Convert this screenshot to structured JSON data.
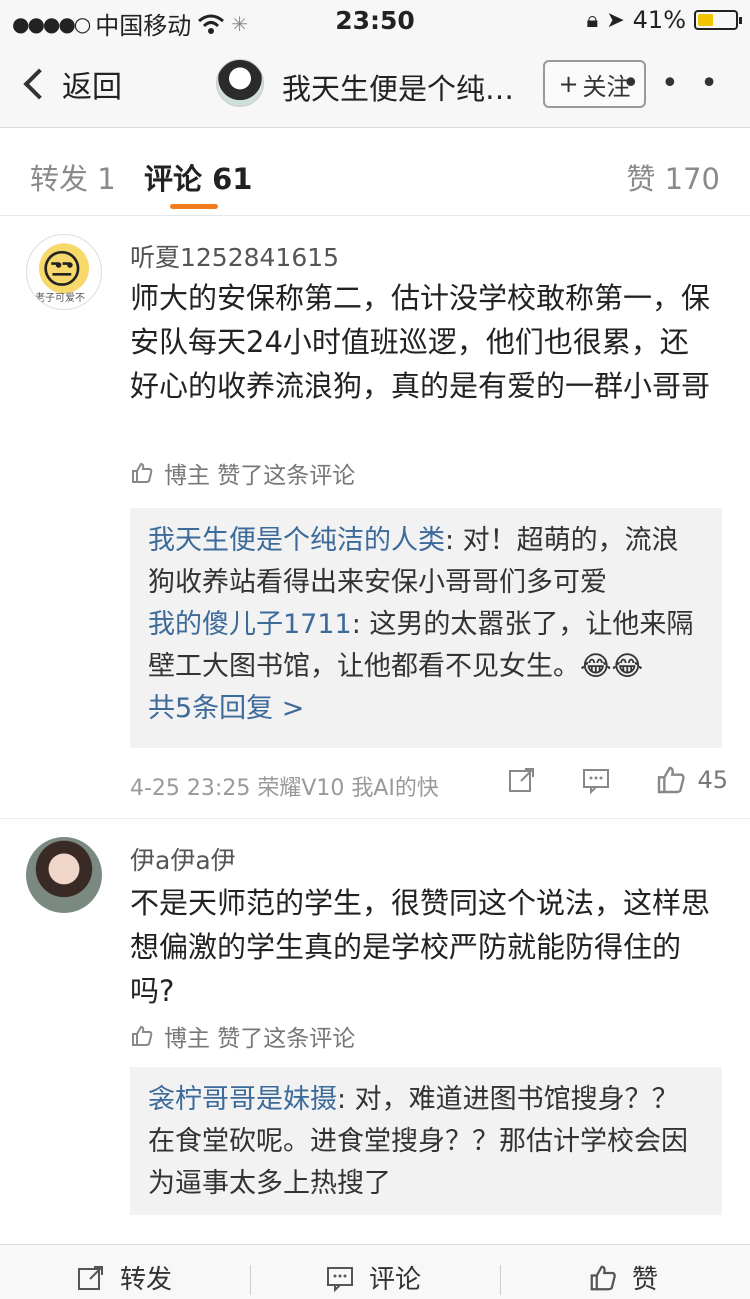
{
  "status_bar": {
    "carrier": "中国移动",
    "time": "23:50",
    "battery": "41%",
    "battery_level": 0.41
  },
  "nav": {
    "back_label": "返回",
    "title": "我天生便是个纯…",
    "follow_label": "关注",
    "more_label": "• • •"
  },
  "tabs": {
    "repost": "转发 1",
    "comments": "评论 61",
    "likes": "赞 170"
  },
  "comments": [
    {
      "username": "听夏1252841615",
      "avatar_caption": "老子可爱不",
      "text": "师大的安保称第二，估计没学校敢称第一，保安队每天24小时值班巡逻，他们也很累，还好心的收养流浪狗，真的是有爱的一群小哥哥",
      "liked_by": "博主 赞了这条评论",
      "replies": [
        {
          "name": "我天生便是个纯洁的人类",
          "text": ": 对！超萌的，流浪狗收养站看得出来安保小哥哥们多可爱"
        },
        {
          "name": "我的傻儿子1711",
          "text": ": 这男的太嚣张了，让他来隔壁工大图书馆，让他都看不见女生。😂😂"
        }
      ],
      "more_replies": "共5条回复 >",
      "meta": "4-25 23:25  荣耀V10 我AI的快",
      "like_count": "45"
    },
    {
      "username": "伊a伊a伊",
      "text": "不是天师范的学生，很赞同这个说法，这样思想偏激的学生真的是学校严防就能防得住的吗?",
      "liked_by": "博主 赞了这条评论",
      "replies": [
        {
          "name": "衾柠哥哥是妹摄",
          "text": ": 对，难道进图书馆搜身？？在食堂砍呢。进食堂搜身？？那估计学校会因为逼事太多上热搜了"
        }
      ]
    }
  ],
  "bottom_bar": {
    "repost": "转发",
    "comment": "评论",
    "like": "赞"
  }
}
